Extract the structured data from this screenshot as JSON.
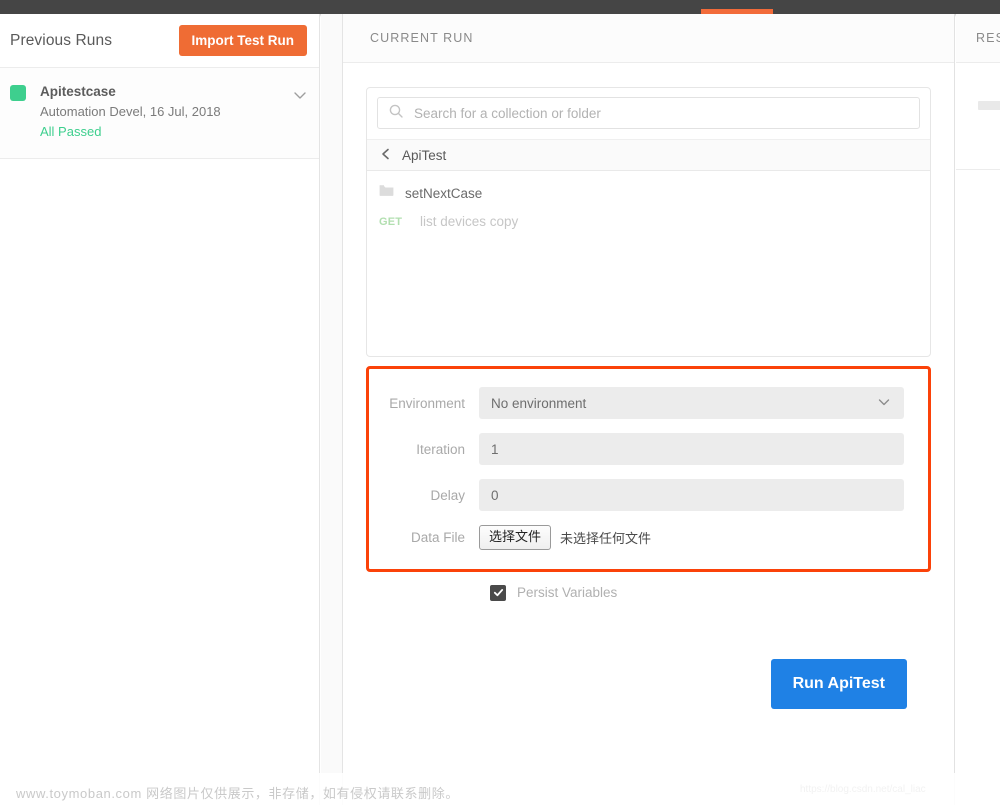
{
  "topbar": {
    "active_tab_color": "#f26b3a",
    "background_color": "#454545"
  },
  "sidebar": {
    "title": "Previous Runs",
    "import_button_label": "Import Test Run",
    "import_button_color": "#ef6c34",
    "runs": [
      {
        "name": "Apitestcase",
        "meta": "Automation Devel, 16 Jul, 2018",
        "result": "All Passed",
        "status_color": "#3ecf8e",
        "chevron_icon": "chevron-down-icon"
      }
    ]
  },
  "main": {
    "header_title": "CURRENT RUN",
    "search": {
      "placeholder": "Search for a collection or folder",
      "value": "",
      "icon": "search-icon"
    },
    "breadcrumb": {
      "back_icon": "chevron-left-icon",
      "label": "ApiTest"
    },
    "tree_items": [
      {
        "type": "folder",
        "icon": "folder-icon",
        "label": "setNextCase"
      },
      {
        "type": "request",
        "method": "GET",
        "method_color": "#b2dfb0",
        "label": "list devices copy"
      }
    ],
    "options": {
      "highlight_color": "#fb4209",
      "environment": {
        "label": "Environment",
        "value": "No environment",
        "chevron_icon": "chevron-down-icon"
      },
      "iteration": {
        "label": "Iteration",
        "value": "1"
      },
      "delay": {
        "label": "Delay",
        "value": "0"
      },
      "data_file": {
        "label": "Data File",
        "button_label": "选择文件",
        "status": "未选择任何文件"
      }
    },
    "persist_variables": {
      "label": "Persist Variables",
      "checked": true,
      "check_icon": "checkmark-icon"
    },
    "run_button": {
      "label": "Run ApiTest",
      "color": "#1f81e5"
    }
  },
  "results_panel": {
    "header_title": "RES"
  },
  "watermarks": {
    "bottom": "www.toymoban.com 网络图片仅供展示，非存储，如有侵权请联系删除。",
    "right": "https://blog.csdn.net/cal_liac"
  }
}
